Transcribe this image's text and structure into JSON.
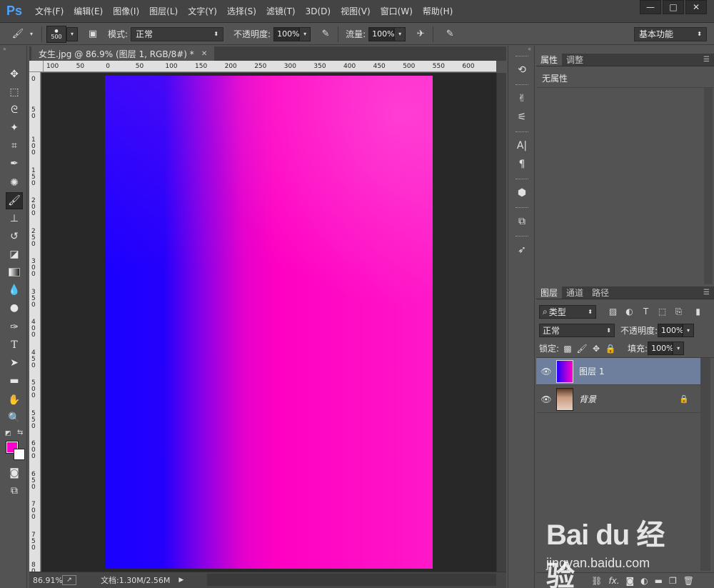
{
  "app": {
    "logo": "Ps"
  },
  "menu": [
    "文件(F)",
    "编辑(E)",
    "图像(I)",
    "图层(L)",
    "文字(Y)",
    "选择(S)",
    "滤镜(T)",
    "3D(D)",
    "视图(V)",
    "窗口(W)",
    "帮助(H)"
  ],
  "options": {
    "brush_size": "500",
    "mode_label": "模式:",
    "mode_value": "正常",
    "opacity_label": "不透明度:",
    "opacity_value": "100%",
    "flow_label": "流量:",
    "flow_value": "100%",
    "workspace": "基本功能"
  },
  "document": {
    "tab_title": "女生.jpg @ 86.9% (图层 1, RGB/8#) *",
    "ruler_h": [
      "100",
      "50",
      "0",
      "50",
      "100",
      "150",
      "200",
      "250",
      "300",
      "350",
      "400",
      "450",
      "500",
      "550",
      "600"
    ],
    "ruler_v": [
      "0",
      "50",
      "100",
      "150",
      "200",
      "250",
      "300",
      "350",
      "400",
      "450",
      "500",
      "550",
      "600",
      "650",
      "700",
      "750",
      "800"
    ],
    "gradient_colors": [
      "#1a00ff",
      "#ff00c2"
    ]
  },
  "status": {
    "zoom": "86.91%",
    "doc_info": "文档:1.30M/2.56M"
  },
  "colors": {
    "foreground": "#ff00cc",
    "background": "#ffffff"
  },
  "properties_panel": {
    "tabs": [
      "属性",
      "调整"
    ],
    "content": "无属性"
  },
  "layers_panel": {
    "tabs": [
      "图层",
      "通道",
      "路径"
    ],
    "filter_label": "类型",
    "blend_mode": "正常",
    "opacity_label": "不透明度:",
    "opacity_value": "100%",
    "lock_label": "锁定:",
    "fill_label": "填充:",
    "fill_value": "100%",
    "layers": [
      {
        "name": "图层 1",
        "selected": true
      },
      {
        "name": "背景",
        "locked": true
      }
    ]
  },
  "watermark": {
    "logo": "Bai du 经验",
    "url": "jingyan.baidu.com"
  }
}
